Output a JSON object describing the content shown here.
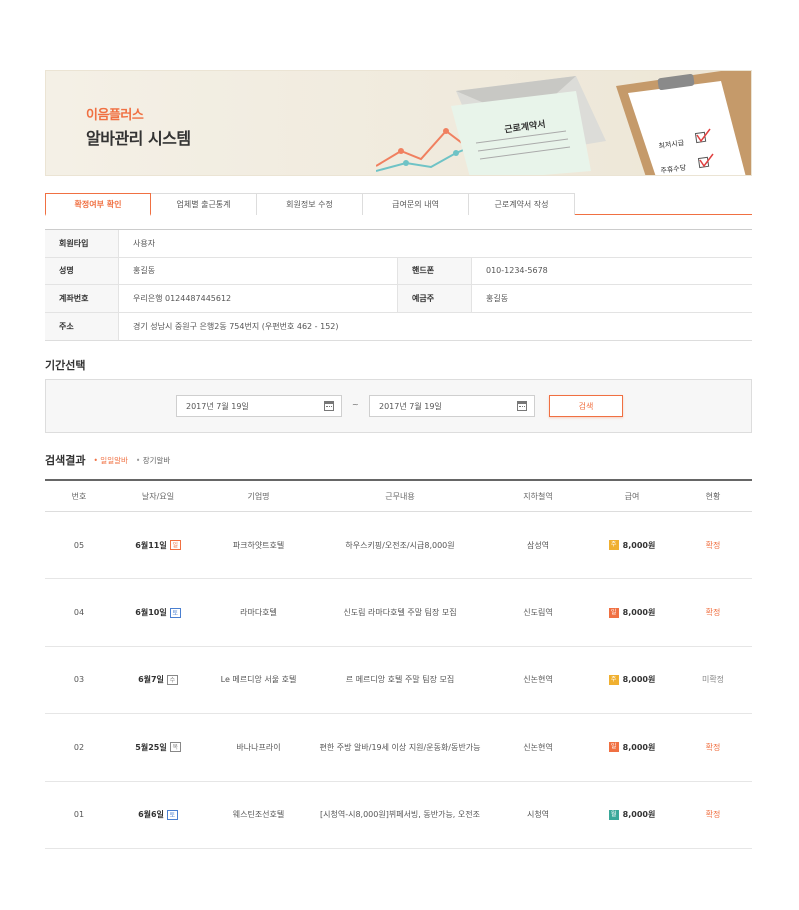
{
  "banner": {
    "brand": "이음플러스",
    "title": "알바관리 시스템",
    "contract_title": "근로계약서",
    "clipboard_item1": "최저시급",
    "clipboard_item2": "주휴수당"
  },
  "tabs": [
    {
      "label": "확정여부 확인",
      "active": true
    },
    {
      "label": "업체별 출근통계",
      "active": false
    },
    {
      "label": "회원정보 수정",
      "active": false
    },
    {
      "label": "급여문의 내역",
      "active": false
    },
    {
      "label": "근로계약서 작성",
      "active": false
    }
  ],
  "member": {
    "type_label": "회원타입",
    "type_value": "사용자",
    "name_label": "성명",
    "name_value": "홍길동",
    "phone_label": "핸드폰",
    "phone_value": "010-1234-5678",
    "account_label": "계좌번호",
    "account_value": "우리은행 0124487445612",
    "holder_label": "예금주",
    "holder_value": "홍길동",
    "address_label": "주소",
    "address_value": "경기 성남시 중원구 은행2동 754번지 (우편번호 462 - 152)"
  },
  "period": {
    "section_title": "기간선택",
    "from": "2017년 7월 19일",
    "separator": "~",
    "to": "2017년 7월 19일",
    "search_label": "검색"
  },
  "results": {
    "title": "검색결과",
    "filter_daily": "일일알바",
    "filter_long": "장기알바",
    "headers": [
      "번호",
      "날자/요일",
      "기업명",
      "근무내용",
      "지하철역",
      "급여",
      "현황"
    ],
    "rows": [
      {
        "no": "05",
        "date": "6월11일",
        "day": "일",
        "day_color": "#f07042",
        "company": "파크하얏트호텔",
        "work": "하우스키핑/오전조/시급8,000원",
        "station": "삼성역",
        "pay_badge": "주",
        "pay_color": "#f0b030",
        "pay": "8,000원",
        "status": "확정",
        "confirmed": true
      },
      {
        "no": "04",
        "date": "6월10일",
        "day": "토",
        "day_color": "#4a7fd0",
        "company": "라마다호텔",
        "work": "신도림 라마다호텔 주말 팀장 모집",
        "station": "신도림역",
        "pay_badge": "일",
        "pay_color": "#f07042",
        "pay": "8,000원",
        "status": "확정",
        "confirmed": true
      },
      {
        "no": "03",
        "date": "6월7일",
        "day": "수",
        "day_color": "#888888",
        "company": "Le 메르디앙 서울 호텔",
        "work": "르 메르디앙 호텔 주말 팀장 모집",
        "station": "신논현역",
        "pay_badge": "주",
        "pay_color": "#f0b030",
        "pay": "8,000원",
        "status": "미확정",
        "confirmed": false
      },
      {
        "no": "02",
        "date": "5월25일",
        "day": "목",
        "day_color": "#888888",
        "company": "바나나프라이",
        "work": "편한 주방 알바/19세 이상 지원/운동화/동반가능",
        "station": "신논현역",
        "pay_badge": "일",
        "pay_color": "#f07042",
        "pay": "8,000원",
        "status": "확정",
        "confirmed": true
      },
      {
        "no": "01",
        "date": "6월6일",
        "day": "토",
        "day_color": "#4a7fd0",
        "company": "웨스틴조선호텔",
        "work": "[시청역-시8,000원]뷔페서빙, 동반가능, 오전조",
        "station": "시청역",
        "pay_badge": "월",
        "pay_color": "#3aa89a",
        "pay": "8,000원",
        "status": "확정",
        "confirmed": true
      }
    ]
  },
  "colors": {
    "accent": "#f07042",
    "pending": "#888888"
  }
}
